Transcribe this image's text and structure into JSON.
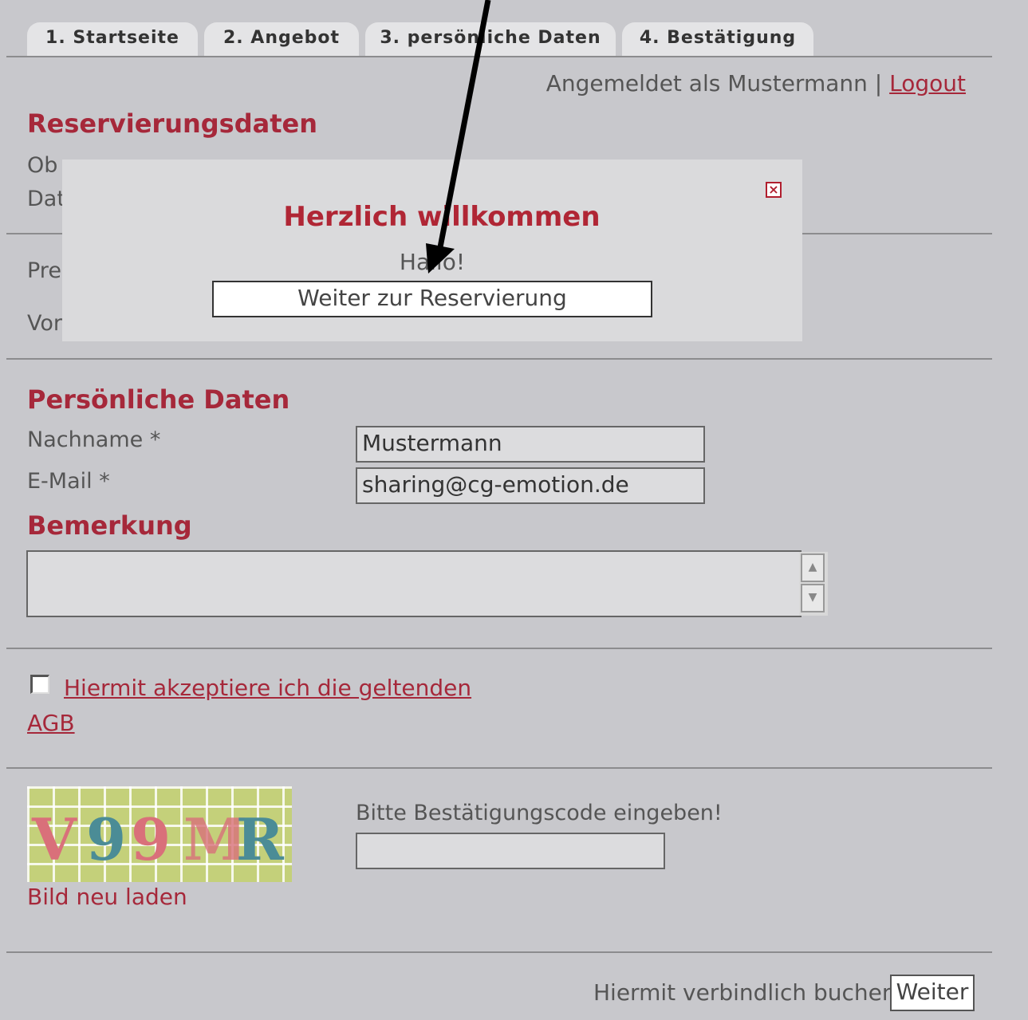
{
  "tabs": [
    "1. Startseite",
    "2. Angebot",
    "3. persönliche Daten",
    "4. Bestätigung"
  ],
  "header": {
    "logged_in_text": "Angemeldet als Mustermann |",
    "logout_label": "Logout"
  },
  "reservation": {
    "heading": "Reservierungsdaten",
    "label_object_partial": "Ob",
    "label_date_partial": "Dat",
    "label_price_partial": "Pre",
    "label_prev_partial": "Vor"
  },
  "modal": {
    "title": "Herzlich willkommen",
    "greeting": "Hallo!",
    "button_label": "Weiter zur Reservierung"
  },
  "personal": {
    "heading": "Persönliche Daten",
    "lastname_label": "Nachname *",
    "lastname_value": "Mustermann",
    "email_label": "E-Mail *",
    "email_value": "sharing@cg-emotion.de"
  },
  "remark": {
    "heading": "Bemerkung",
    "value": ""
  },
  "terms": {
    "line1": "Hiermit akzeptiere ich die geltenden",
    "line2": "AGB",
    "checked": false
  },
  "captcha": {
    "chars": [
      "V",
      "9",
      "9",
      "M",
      "R"
    ],
    "prompt": "Bitte Bestätigungscode eingeben!",
    "reload_label": "Bild neu laden",
    "input_value": ""
  },
  "footer": {
    "confirm_text": "Hiermit verbindlich buchen",
    "button_label": "Weiter"
  },
  "icons": {
    "close": "close-icon",
    "scroll_up": "scroll-up-icon",
    "scroll_down": "scroll-down-icon",
    "arrow": "annotation-arrow"
  }
}
